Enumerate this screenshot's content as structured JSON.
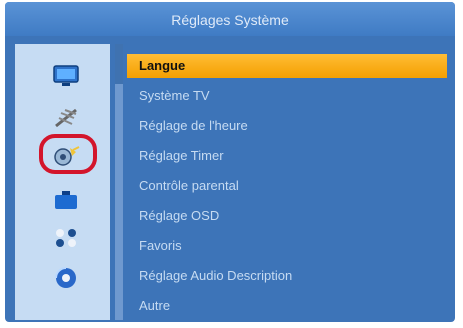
{
  "window": {
    "title": "Réglages Système"
  },
  "sidebar": {
    "icons": [
      {
        "name": "tv-icon"
      },
      {
        "name": "antenna-icon"
      },
      {
        "name": "system-settings-icon"
      },
      {
        "name": "toolbox-icon"
      },
      {
        "name": "grid-icon"
      },
      {
        "name": "media-icon"
      }
    ],
    "selected_index": 2
  },
  "menu": {
    "items": [
      {
        "label": "Langue"
      },
      {
        "label": "Système TV"
      },
      {
        "label": "Réglage de l'heure"
      },
      {
        "label": "Réglage Timer"
      },
      {
        "label": "Contrôle parental"
      },
      {
        "label": "Réglage OSD"
      },
      {
        "label": "Favoris"
      },
      {
        "label": "Réglage Audio Description"
      },
      {
        "label": "Autre"
      }
    ],
    "selected_index": 0
  },
  "colors": {
    "background": "#3d74b8",
    "title_text": "#dfeaf8",
    "menu_text": "#c6dbf2",
    "selection_bar": "#f7a600",
    "highlight_ring": "#d3152b"
  }
}
